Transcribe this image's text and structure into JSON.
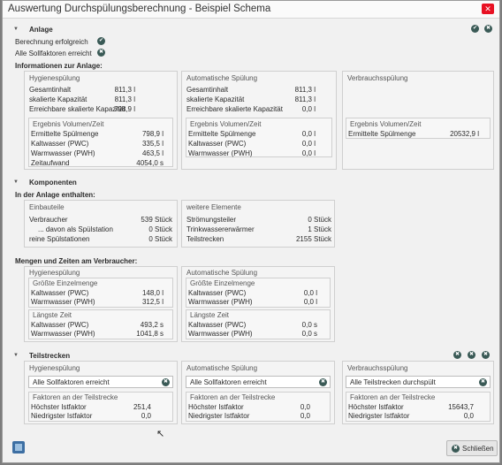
{
  "window": {
    "title": "Auswertung Durchspülungsberechnung - Beispiel Schema",
    "close": "✕"
  },
  "anlage": {
    "header": "Anlage",
    "status1": "Berechnung erfolgreich",
    "status2": "Alle Sollfaktoren erreicht",
    "info_title": "Informationen zur Anlage:",
    "hygiene": {
      "title": "Hygienespülung",
      "rows": [
        {
          "label": "Gesamtinhalt",
          "value": "811,3 l"
        },
        {
          "label": "skalierte Kapazität",
          "value": "811,3 l"
        },
        {
          "label": "Erreichbare skalierte Kapazität",
          "value": "798,9 l"
        }
      ],
      "sub_title": "Ergebnis Volumen/Zeit",
      "sub_rows": [
        {
          "label": "Ermittelte Spülmenge",
          "value": "798,9 l"
        },
        {
          "label": "Kaltwasser (PWC)",
          "value": "335,5 l"
        },
        {
          "label": "Warmwasser (PWH)",
          "value": "463,5 l"
        },
        {
          "label": "Zeitaufwand",
          "value": "4054,0 s"
        }
      ]
    },
    "auto": {
      "title": "Automatische Spülung",
      "rows": [
        {
          "label": "Gesamtinhalt",
          "value": "811,3 l"
        },
        {
          "label": "skalierte Kapazität",
          "value": "811,3 l"
        },
        {
          "label": "Erreichbare skalierte Kapazität",
          "value": "0,0 l"
        }
      ],
      "sub_title": "Ergebnis Volumen/Zeit",
      "sub_rows": [
        {
          "label": "Ermittelte Spülmenge",
          "value": "0,0 l"
        },
        {
          "label": "Kaltwasser (PWC)",
          "value": "0,0 l"
        },
        {
          "label": "Warmwasser (PWH)",
          "value": "0,0 l"
        }
      ]
    },
    "verbrauch": {
      "title": "Verbrauchsspülung",
      "sub_title": "Ergebnis Volumen/Zeit",
      "sub_rows": [
        {
          "label": "Ermittelte Spülmenge",
          "value": "20532,9 l"
        }
      ]
    }
  },
  "komponenten": {
    "header": "Komponenten",
    "enthalten_title": "In der Anlage enthalten:",
    "einbauteile": {
      "title": "Einbauteile",
      "rows": [
        {
          "label": "Verbraucher",
          "value": "539 Stück"
        },
        {
          "label": "... davon als Spülstation",
          "value": "0 Stück"
        },
        {
          "label": "reine Spülstationen",
          "value": "0 Stück"
        }
      ]
    },
    "weitere": {
      "title": "weitere Elemente",
      "rows": [
        {
          "label": "Strömungsteiler",
          "value": "0 Stück"
        },
        {
          "label": "Trinkwassererwärmer",
          "value": "1 Stück"
        },
        {
          "label": "Teilstrecken",
          "value": "2155 Stück"
        }
      ]
    },
    "mengen_title": "Mengen und Zeiten am Verbraucher:",
    "hygiene": {
      "title": "Hygienespülung",
      "e_title": "Größte Einzelmenge",
      "e_rows": [
        {
          "label": "Kaltwasser (PWC)",
          "value": "148,0 l"
        },
        {
          "label": "Warmwasser (PWH)",
          "value": "312,5 l"
        }
      ],
      "z_title": "Längste Zeit",
      "z_rows": [
        {
          "label": "Kaltwasser (PWC)",
          "value": "493,2 s"
        },
        {
          "label": "Warmwasser (PWH)",
          "value": "1041,8 s"
        }
      ]
    },
    "auto": {
      "title": "Automatische Spülung",
      "e_title": "Größte Einzelmenge",
      "e_rows": [
        {
          "label": "Kaltwasser (PWC)",
          "value": "0,0 l"
        },
        {
          "label": "Warmwasser (PWH)",
          "value": "0,0 l"
        }
      ],
      "z_title": "Längste Zeit",
      "z_rows": [
        {
          "label": "Kaltwasser (PWC)",
          "value": "0,0 s"
        },
        {
          "label": "Warmwasser (PWH)",
          "value": "0,0 s"
        }
      ]
    }
  },
  "teilstrecken": {
    "header": "Teilstrecken",
    "hygiene": {
      "title": "Hygienespülung",
      "status": "Alle Sollfaktoren erreicht",
      "sub_title": "Faktoren an der Teilstrecke",
      "rows": [
        {
          "label": "Höchster Istfaktor",
          "value": "251,4"
        },
        {
          "label": "Niedrigster Istfaktor",
          "value": "0,0"
        }
      ]
    },
    "auto": {
      "title": "Automatische Spülung",
      "status": "Alle Sollfaktoren erreicht",
      "sub_title": "Faktoren an der Teilstrecke",
      "rows": [
        {
          "label": "Höchster Istfaktor",
          "value": "0,0"
        },
        {
          "label": "Niedrigster Istfaktor",
          "value": "0,0"
        }
      ]
    },
    "verbrauch": {
      "title": "Verbrauchsspülung",
      "status": "Alle Teilstrecken durchspült",
      "sub_title": "Faktoren an der Teilstrecke",
      "rows": [
        {
          "label": "Höchster Istfaktor",
          "value": "15643,7"
        },
        {
          "label": "Niedrigster Istfaktor",
          "value": "0,0"
        }
      ]
    }
  },
  "footer": {
    "close_button": "Schließen"
  },
  "icons": {
    "ok": "✔",
    "x": "✖",
    "expand": "▼"
  }
}
